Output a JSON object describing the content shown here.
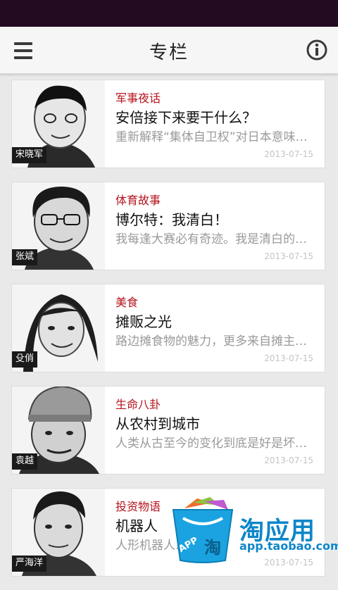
{
  "status_bar": {},
  "header": {
    "title": "专栏",
    "menu_icon": "hamburger-menu-icon",
    "info_icon": "info-circle-icon"
  },
  "columns": [
    {
      "author": "宋晓军",
      "category": "军事夜话",
      "headline": "安倍接下来要干什么？",
      "summary": "重新解释“集体自卫权”对日本意味…",
      "date": "2013-07-15"
    },
    {
      "author": "张斌",
      "category": "体育故事",
      "headline": "博尔特：我清白！",
      "summary": "我每逢大赛必有奇迹。我是清白的…",
      "date": "2013-07-15"
    },
    {
      "author": "殳俏",
      "category": "美食",
      "headline": "摊贩之光",
      "summary": "路边摊食物的魅力，更多来自摊主…",
      "date": "2013-07-15"
    },
    {
      "author": "袁越",
      "category": "生命八卦",
      "headline": "从农村到城市",
      "summary": "人类从古至今的变化到底是好是坏…",
      "date": "2013-07-15"
    },
    {
      "author": "严海洋",
      "category": "投资物语",
      "headline": "机器人",
      "summary": "人形机器人…",
      "date": "2013-07-15"
    }
  ],
  "promo": {
    "text": "淘应用",
    "url": "app.taobao.com",
    "icon": "taobao-shopping-bag-icon",
    "bag_label": "APP",
    "bag_char": "淘"
  },
  "colors": {
    "status_bar": "#230b22",
    "accent_category": "#b5121b",
    "promo_blue": "#0d86c9"
  }
}
